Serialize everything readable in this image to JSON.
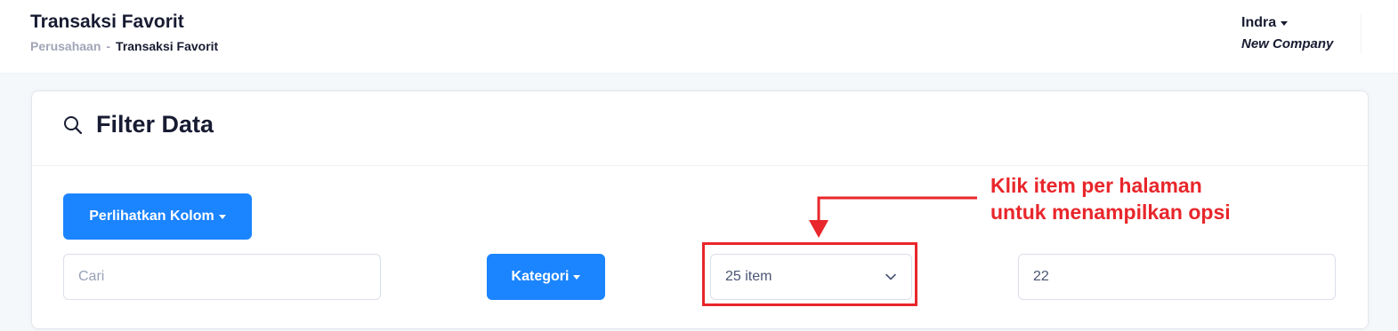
{
  "header": {
    "title": "Transaksi Favorit",
    "breadcrumb": {
      "parent": "Perusahaan",
      "separator": "-",
      "current": "Transaksi Favorit"
    },
    "user": {
      "name": "Indra",
      "company": "New Company"
    }
  },
  "filter_card": {
    "title": "Filter Data",
    "title_icon": "search-icon",
    "columns_button_label": "Perlihatkan Kolom",
    "search_placeholder": "Cari",
    "category_button_label": "Kategori",
    "per_page_value": "25 item",
    "page_value": "22"
  },
  "annotation": {
    "line1": "Klik item per halaman",
    "line2": "untuk menampilkan opsi",
    "color": "#e8262b"
  },
  "colors": {
    "primary": "#1b84ff",
    "annotation": "#e8262b"
  }
}
